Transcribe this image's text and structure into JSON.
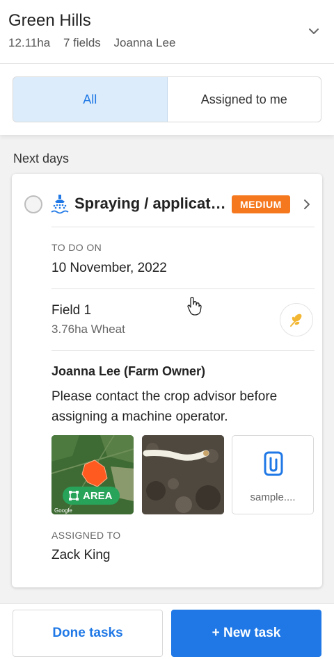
{
  "header": {
    "farm_name": "Green Hills",
    "area": "12.11ha",
    "fields": "7 fields",
    "owner": "Joanna Lee",
    "expand_icon": "chevron-down-icon"
  },
  "tabs": [
    {
      "label": "All",
      "active": true
    },
    {
      "label": "Assigned to me",
      "active": false
    }
  ],
  "section_title": "Next days",
  "task": {
    "icon": "sprayer-icon",
    "title": "Spraying / application",
    "priority": "MEDIUM",
    "priority_color": "#f5781f",
    "todo_label": "TO DO ON",
    "todo_date": "10 November, 2022",
    "field_name": "Field 1",
    "field_detail": "3.76ha Wheat",
    "crop_icon": "wheat-icon",
    "note_author": "Joanna Lee (Farm Owner)",
    "note_text": "Please contact the crop advisor before assigning a machine operator.",
    "attachments": {
      "area_label": "AREA",
      "map_credit": "Google",
      "file_name": "sample...."
    },
    "assigned_label": "ASSIGNED TO",
    "assigned_to": "Zack King"
  },
  "footer": {
    "done_label": "Done tasks",
    "new_label": "+ New task"
  },
  "colors": {
    "accent": "#1f78e6",
    "active_tab_bg": "#dcecfa",
    "area_tag": "#27a35a"
  }
}
